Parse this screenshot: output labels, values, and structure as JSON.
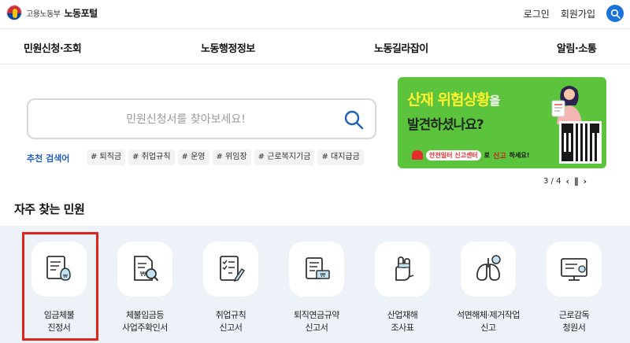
{
  "header": {
    "ministry": "고용노동부",
    "portal": "노동포털",
    "login": "로그인",
    "signup": "회원가입"
  },
  "nav": {
    "items": [
      {
        "label": "민원신청·조회"
      },
      {
        "label": "노동행정정보"
      },
      {
        "label": "노동길라잡이"
      },
      {
        "label": "알림·소통"
      }
    ]
  },
  "search": {
    "placeholder": "민원신청서를 찾아보세요!",
    "value": "",
    "keywords_label": "추천 검색어",
    "keywords": [
      "# 퇴직금",
      "# 취업규칙",
      "# 운영",
      "# 위임장",
      "# 근로복지기금",
      "# 대지급금"
    ]
  },
  "banner": {
    "title_line1": "산재 위험상황",
    "title_particle": "을",
    "title_line2": "발견하셨나요?",
    "report_center": "안전일터 신고센터",
    "report_suffix_a": "로",
    "report_strong": "신고",
    "report_suffix_b": "하세요!",
    "pager_text": "3 / 4",
    "colors": {
      "background": "#5cc43c",
      "headline": "#fff12e"
    }
  },
  "frequent": {
    "title": "자주 찾는 민원",
    "items": [
      {
        "label": "임금체불\n진정서",
        "icon": "wage-document-icon"
      },
      {
        "label": "체불임금등\n사업주확인서",
        "icon": "document-search-icon"
      },
      {
        "label": "취업규칙\n신고서",
        "icon": "checklist-icon"
      },
      {
        "label": "퇴직연금규약\n신고서",
        "icon": "pension-scroll-icon"
      },
      {
        "label": "산업재해\n조사표",
        "icon": "injured-hand-icon"
      },
      {
        "label": "석면해체·제거작업\n신고",
        "icon": "lungs-icon"
      },
      {
        "label": "근로감독\n청원서",
        "icon": "monitor-icon"
      }
    ]
  },
  "colors": {
    "accent": "#1a73d9",
    "highlight": "#e0261c",
    "section_bg": "#edf1f8"
  }
}
